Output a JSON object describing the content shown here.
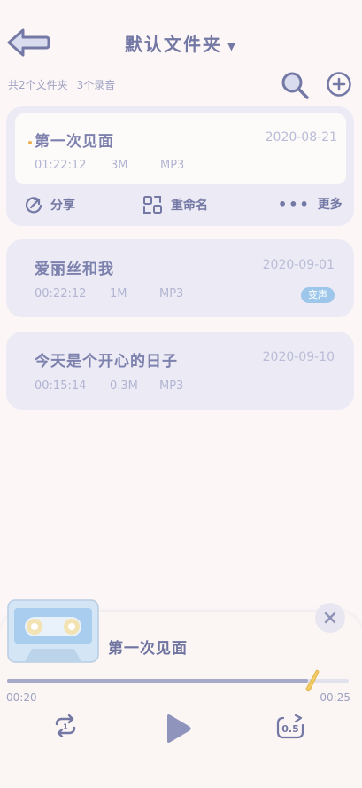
{
  "header": {
    "title": "默认文件夹",
    "summary_folders": "共2个文件夹",
    "summary_recordings": "3个录音"
  },
  "recordings": [
    {
      "name": "第一次见面",
      "date": "2020-08-21",
      "duration": "01:22:12",
      "size": "3M",
      "format": "MP3"
    },
    {
      "name": "爱丽丝和我",
      "date": "2020-09-01",
      "duration": "00:22:12",
      "size": "1M",
      "format": "MP3",
      "badge": "变声"
    },
    {
      "name": "今天是个开心的日子",
      "date": "2020-09-10",
      "duration": "00:15:14",
      "size": "0.3M",
      "format": "MP3"
    }
  ],
  "actions": {
    "share": "分享",
    "rename": "重命名",
    "more": "更多"
  },
  "player": {
    "title": "第一次见面",
    "time_current": "00:20",
    "time_total": "00:25",
    "progress": 0.88,
    "speed": "0.5"
  },
  "colors": {
    "accent": "#7478a4",
    "card": "#ebeaf5",
    "badge": "#9dc7ea",
    "dot": "#f0b24e"
  }
}
